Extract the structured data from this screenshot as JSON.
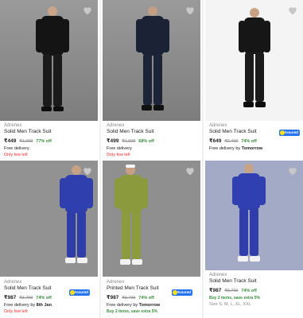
{
  "colors": {
    "price_off": "#388e3c",
    "few_left": "#ff6161",
    "assured_badge": "#2874f0",
    "muted": "#878787"
  },
  "assured_badge_text": "Assured",
  "products": [
    {
      "brand": "Adrenex",
      "title": "Solid Men Track Suit",
      "price": "₹449",
      "mrp": "₹1,999",
      "off": "77% off",
      "delivery_prefix": "Free delivery",
      "delivery_day": "",
      "tag": "Only few left",
      "assured": false,
      "sizes": ""
    },
    {
      "brand": "Adrenex",
      "title": "Solid Men Track Suit",
      "price": "₹499",
      "mrp": "₹1,999",
      "off": "68% off",
      "delivery_prefix": "Free delivery",
      "delivery_day": "",
      "tag": "Only few left",
      "assured": false,
      "sizes": ""
    },
    {
      "brand": "Adrenex",
      "title": "Solid Men Track Suit",
      "price": "₹649",
      "mrp": "₹2,499",
      "off": "74% off",
      "delivery_prefix": "Free delivery by",
      "delivery_day": "Tomorrow",
      "tag": "",
      "assured": true,
      "sizes": ""
    },
    {
      "brand": "Adrenex",
      "title": "Solid Men Track Suit",
      "price": "₹987",
      "mrp": "₹3,799",
      "off": "74% off",
      "delivery_prefix": "Free delivery by",
      "delivery_day": "8th Jan",
      "tag": "Only few left",
      "assured": true,
      "sizes": ""
    },
    {
      "brand": "Adrenex",
      "title": "Printed Men Track Suit",
      "price": "₹987",
      "mrp": "₹3,799",
      "off": "74% off",
      "delivery_prefix": "Free delivery by",
      "delivery_day": "Tomorrow",
      "tag": "Buy 2 items, save extra 5%",
      "assured": true,
      "sizes": ""
    },
    {
      "brand": "Adrenex",
      "title": "Solid Men Track Suit",
      "price": "₹987",
      "mrp": "₹3,799",
      "off": "74% off",
      "delivery_prefix": "",
      "delivery_day": "",
      "tag": "Buy 2 items, save extra 5%",
      "assured": false,
      "sizes": "Size S, M, L, XL, XXL"
    }
  ]
}
